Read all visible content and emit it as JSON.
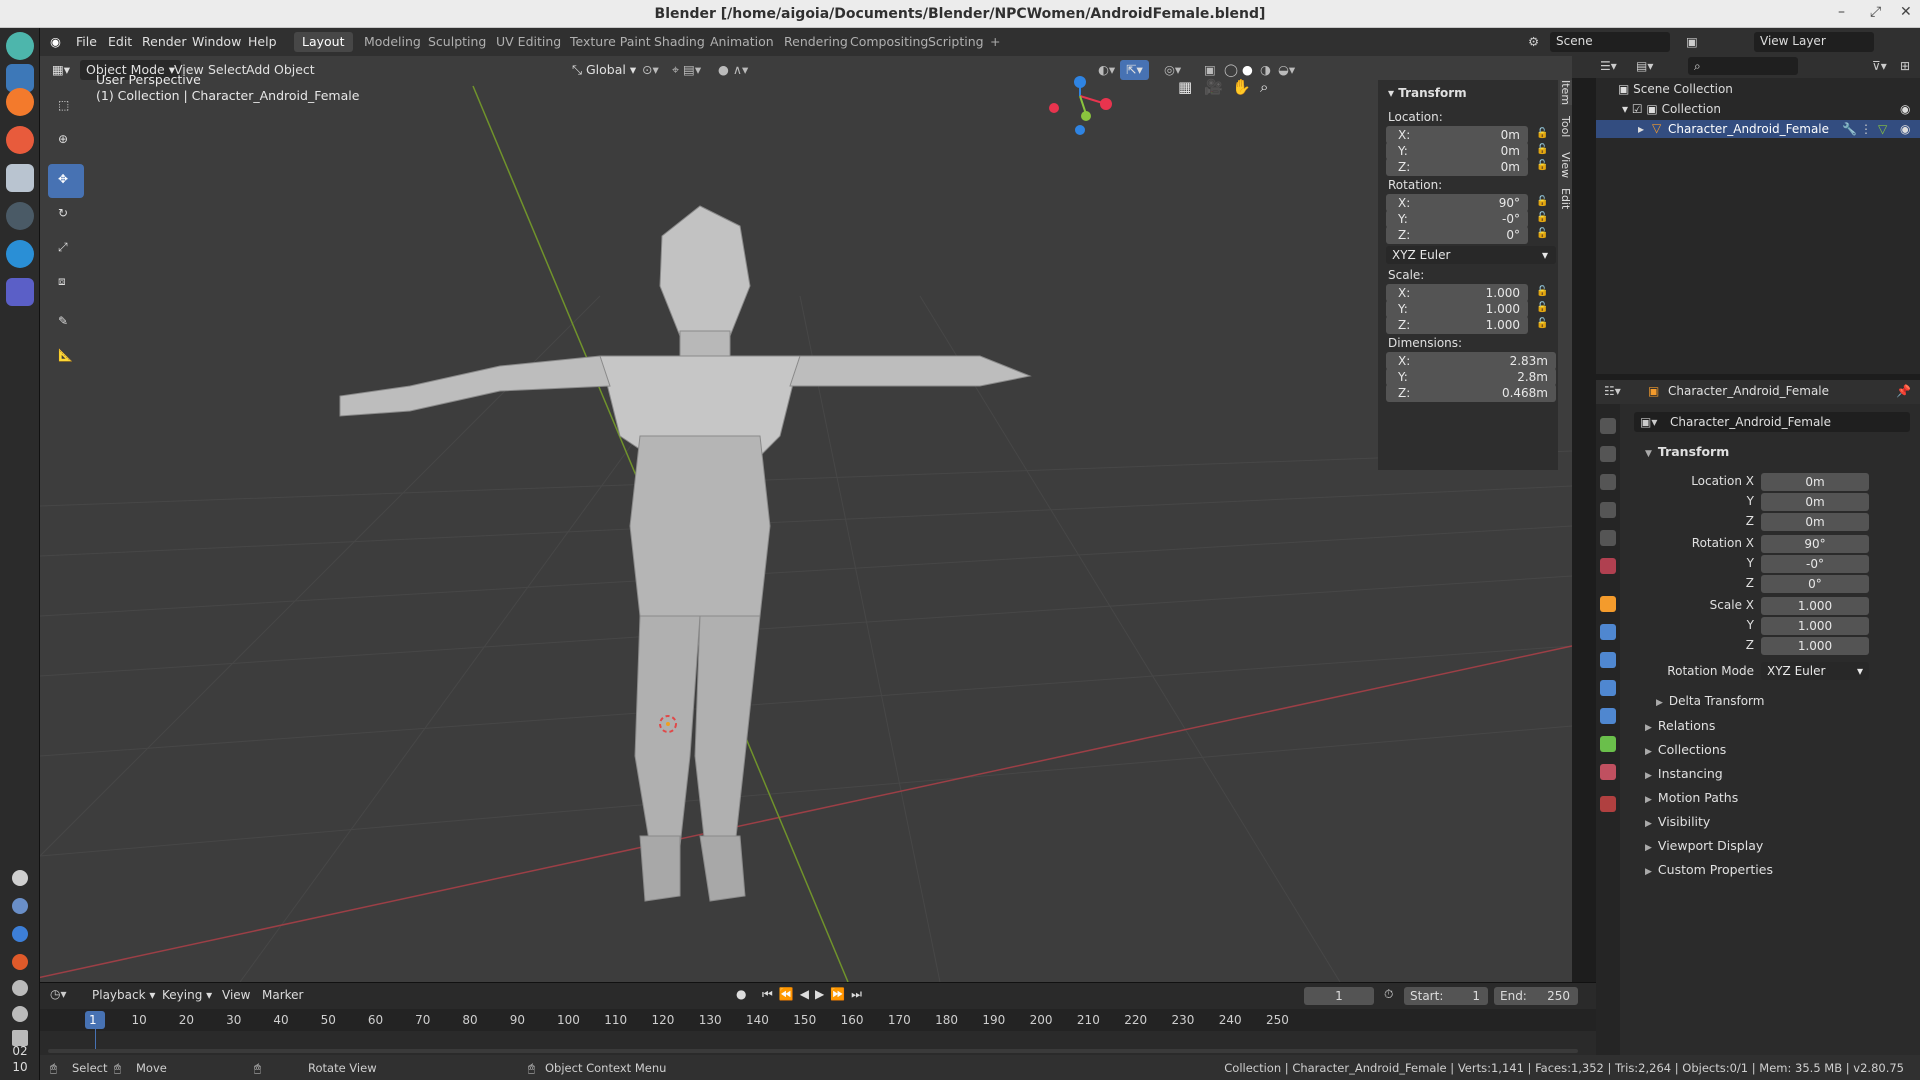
{
  "window": {
    "title": "Blender [/home/aigoia/Documents/Blender/NPCWomen/AndroidFemale.blend]"
  },
  "menus": [
    "File",
    "Edit",
    "Render",
    "Window",
    "Help"
  ],
  "workspaces": [
    "Layout",
    "Modeling",
    "Sculpting",
    "UV Editing",
    "Texture Paint",
    "Shading",
    "Animation",
    "Rendering",
    "Compositing",
    "Scripting"
  ],
  "active_workspace": "Layout",
  "scene": {
    "name": "Scene",
    "view_layer": "View Layer"
  },
  "viewport": {
    "mode": "Object Mode",
    "menus": [
      "View",
      "Select",
      "Add",
      "Object"
    ],
    "orientation": "Global",
    "perspective_label": "User Perspective",
    "collection_label": "(1) Collection | Character_Android_Female"
  },
  "npanel": {
    "title": "Transform",
    "location_label": "Location:",
    "location": [
      {
        "k": "X:",
        "v": "0m"
      },
      {
        "k": "Y:",
        "v": "0m"
      },
      {
        "k": "Z:",
        "v": "0m"
      }
    ],
    "rotation_label": "Rotation:",
    "rotation": [
      {
        "k": "X:",
        "v": "90°"
      },
      {
        "k": "Y:",
        "v": "-0°"
      },
      {
        "k": "Z:",
        "v": "0°"
      }
    ],
    "rotation_mode": "XYZ Euler",
    "scale_label": "Scale:",
    "scale": [
      {
        "k": "X:",
        "v": "1.000"
      },
      {
        "k": "Y:",
        "v": "1.000"
      },
      {
        "k": "Z:",
        "v": "1.000"
      }
    ],
    "dimensions_label": "Dimensions:",
    "dimensions": [
      {
        "k": "X:",
        "v": "2.83m"
      },
      {
        "k": "Y:",
        "v": "2.8m"
      },
      {
        "k": "Z:",
        "v": "0.468m"
      }
    ],
    "tabs": [
      "Item",
      "Tool",
      "View",
      "Edit"
    ]
  },
  "outliner": {
    "root": "Scene Collection",
    "collection": "Collection",
    "object": "Character_Android_Female"
  },
  "properties": {
    "object_name": "Character_Android_Female",
    "object_field": "Character_Android_Female",
    "transform_title": "Transform",
    "location_x_label": "Location X",
    "rotation_x_label": "Rotation X",
    "scale_x_label": "Scale X",
    "y_label": "Y",
    "z_label": "Z",
    "location": [
      "0m",
      "0m",
      "0m"
    ],
    "rotation": [
      "90°",
      "-0°",
      "0°"
    ],
    "scale": [
      "1.000",
      "1.000",
      "1.000"
    ],
    "rotation_mode_label": "Rotation Mode",
    "rotation_mode": "XYZ Euler",
    "delta": "Delta Transform",
    "sections": [
      "Relations",
      "Collections",
      "Instancing",
      "Motion Paths",
      "Visibility",
      "Viewport Display",
      "Custom Properties"
    ]
  },
  "timeline": {
    "menus": [
      "Playback",
      "Keying",
      "View",
      "Marker"
    ],
    "current_frame": "1",
    "start_label": "Start:",
    "start": "1",
    "end_label": "End:",
    "end": "250",
    "ruler": [
      "1",
      "10",
      "20",
      "30",
      "40",
      "50",
      "60",
      "70",
      "80",
      "90",
      "100",
      "110",
      "120",
      "130",
      "140",
      "150",
      "160",
      "170",
      "180",
      "190",
      "200",
      "210",
      "220",
      "230",
      "240",
      "250"
    ]
  },
  "statusbar": {
    "select": "Select",
    "move": "Move",
    "rotate": "Rotate View",
    "context": "Object Context Menu",
    "stats": "Collection | Character_Android_Female | Verts:1,141 | Faces:1,352 | Tris:2,264 | Objects:0/1 | Mem: 35.5 MB | v2.80.75"
  },
  "clock": {
    "hour": "02",
    "minute": "10"
  },
  "colors": {
    "accent": "#4772b3",
    "axis_x": "#e8344e",
    "axis_y": "#8ac43e",
    "axis_z": "#2f84e3",
    "object_orange": "#f49b2c"
  }
}
